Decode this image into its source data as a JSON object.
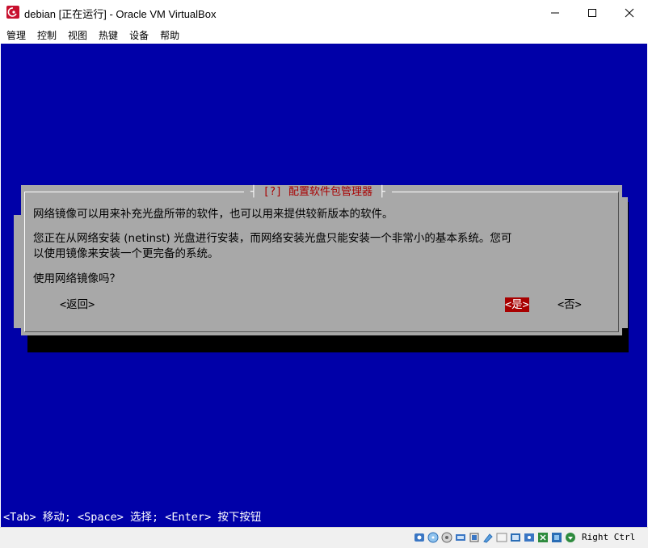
{
  "window": {
    "title": "debian [正在运行] - Oracle VM VirtualBox",
    "controls": {
      "minimize": "—",
      "maximize": "☐",
      "close": "✕"
    }
  },
  "menu": [
    "管理",
    "控制",
    "视图",
    "热键",
    "设备",
    "帮助"
  ],
  "dialog": {
    "title_prefix": "[?]",
    "title": "配置软件包管理器",
    "paragraph1": "网络镜像可以用来补充光盘所带的软件，也可以用来提供较新版本的软件。",
    "paragraph2_line1": "您正在从网络安装 (netinst) 光盘进行安装，而网络安装光盘只能安装一个非常小的基本系统。您可",
    "paragraph2_line2": "以使用镜像来安装一个更完备的系统。",
    "question": "使用网络镜像吗？",
    "buttons": {
      "back": "<返回>",
      "yes": "<是>",
      "no": "<否>"
    }
  },
  "help_line": "<Tab> 移动; <Space> 选择; <Enter> 按下按钮",
  "statusbar": {
    "icons": [
      "hard-disk-icon",
      "optical-drive-icon",
      "audio-icon",
      "network-icon",
      "usb-icon",
      "shared-folder-icon",
      "display-icon",
      "video-capture-icon",
      "mouse-integration-icon",
      "recording-icon",
      "cpu-icon",
      "keyboard-arrow-icon"
    ],
    "host_key": "Right Ctrl"
  },
  "colors": {
    "vm_background": "#0000a8",
    "dialog_background": "#a8a8a8",
    "title_text": "#a80000",
    "selected_button": "#a80000"
  }
}
